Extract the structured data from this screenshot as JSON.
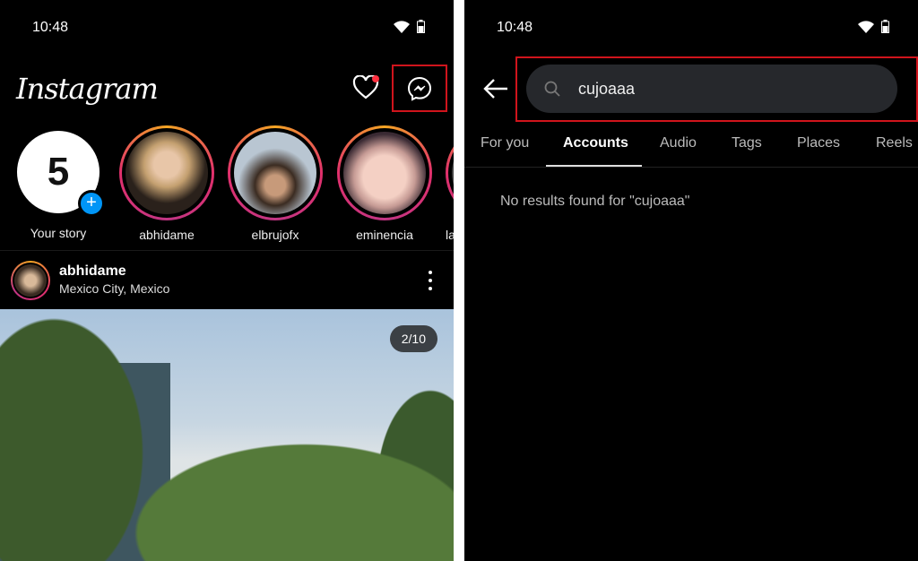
{
  "left": {
    "status": {
      "time": "10:48"
    },
    "header": {
      "logo": "Instagram",
      "icons": [
        "heart-icon",
        "messenger-icon"
      ]
    },
    "stories": [
      {
        "label": "Your story"
      },
      {
        "label": "abhidame"
      },
      {
        "label": "elbrujofx"
      },
      {
        "label": "eminencia"
      },
      {
        "label": "la"
      }
    ],
    "post": {
      "username": "abhidame",
      "location": "Mexico City, Mexico",
      "counter": "2/10"
    }
  },
  "right": {
    "status": {
      "time": "10:48"
    },
    "search": {
      "value": "cujoaaa"
    },
    "tabs": [
      {
        "label": "For you"
      },
      {
        "label": "Accounts",
        "active": true
      },
      {
        "label": "Audio"
      },
      {
        "label": "Tags"
      },
      {
        "label": "Places"
      },
      {
        "label": "Reels"
      }
    ],
    "empty_message": "No results found for \"cujoaaa\""
  },
  "colors": {
    "highlight": "#d0141c",
    "notification": "#ff3040",
    "add_badge": "#0095f6"
  }
}
